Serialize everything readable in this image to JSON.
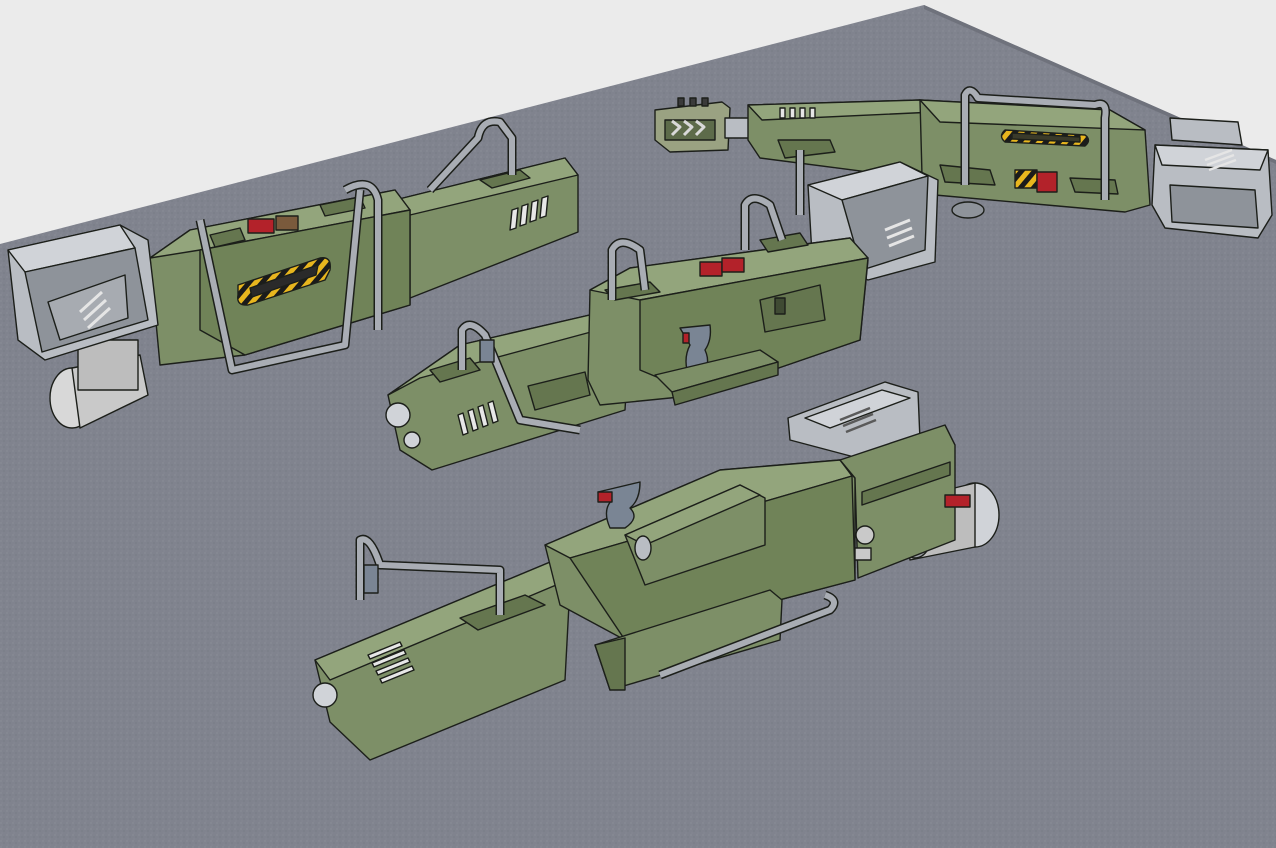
{
  "scene": {
    "description_free": true,
    "colors": {
      "background": "#ebebeb",
      "mat": "#80838e",
      "mat_dark": "#6f727c",
      "body": "#7d8f67",
      "body_light": "#93a57c",
      "body_dark": "#65764f",
      "metal": "#b9bdc3",
      "metal_dark": "#8e939a",
      "pipe": "#a9adb4",
      "accent_red": "#b3222a",
      "hazard_yellow": "#e8b61e",
      "grip": "#7a8594",
      "outline": "#1c1f1a"
    },
    "objects": [
      {
        "name": "weapon-upper-left"
      },
      {
        "name": "weapon-upper-right"
      },
      {
        "name": "weapon-middle"
      },
      {
        "name": "weapon-bottom"
      }
    ]
  }
}
